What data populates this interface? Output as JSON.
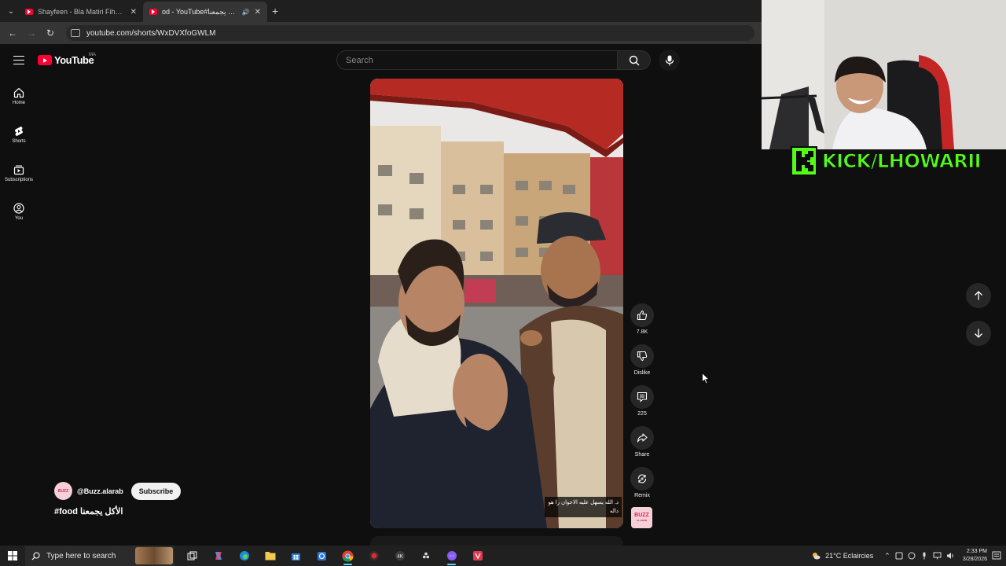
{
  "browser": {
    "tabs": [
      {
        "title": "Shayfeen - Bla Matiri Fihoum (I",
        "active": false
      },
      {
        "title": "od - YouTube#الأكل يجمعنا",
        "active": true
      }
    ],
    "address": "youtube.com/shorts/WxDVXfoGWLM"
  },
  "youtube": {
    "logo_text": "YouTube",
    "region": "MA",
    "search_placeholder": "Search",
    "guide": [
      {
        "label": "Home",
        "icon": "home-icon"
      },
      {
        "label": "Shorts",
        "icon": "shorts-icon"
      },
      {
        "label": "Subscriptions",
        "icon": "subscriptions-icon"
      },
      {
        "label": "You",
        "icon": "account-icon"
      }
    ]
  },
  "short": {
    "caption_line1": "د. الله يسهل عليه الاخوان را هو",
    "caption_line2": "داله",
    "actions": [
      {
        "label": "7.8K",
        "icon": "like-icon"
      },
      {
        "label": "Dislike",
        "icon": "dislike-icon"
      },
      {
        "label": "225",
        "icon": "comment-icon"
      },
      {
        "label": "Share",
        "icon": "share-icon"
      },
      {
        "label": "Remix",
        "icon": "remix-icon"
      }
    ],
    "channel_badge_line1": "BUZZ",
    "channel_badge_line2": "AL ARAB",
    "channel": "@Buzz.alarab",
    "subscribe_label": "Subscribe",
    "title": "#food الأكل يجمعنا"
  },
  "stream_overlay": {
    "kick_text": "KICK/LHOWARII",
    "kick_color": "#53fc18"
  },
  "taskbar": {
    "search_placeholder": "Type here to search",
    "weather": "21°C  Eclaircies",
    "time": "2:33 PM",
    "date": "3/28/2026"
  }
}
